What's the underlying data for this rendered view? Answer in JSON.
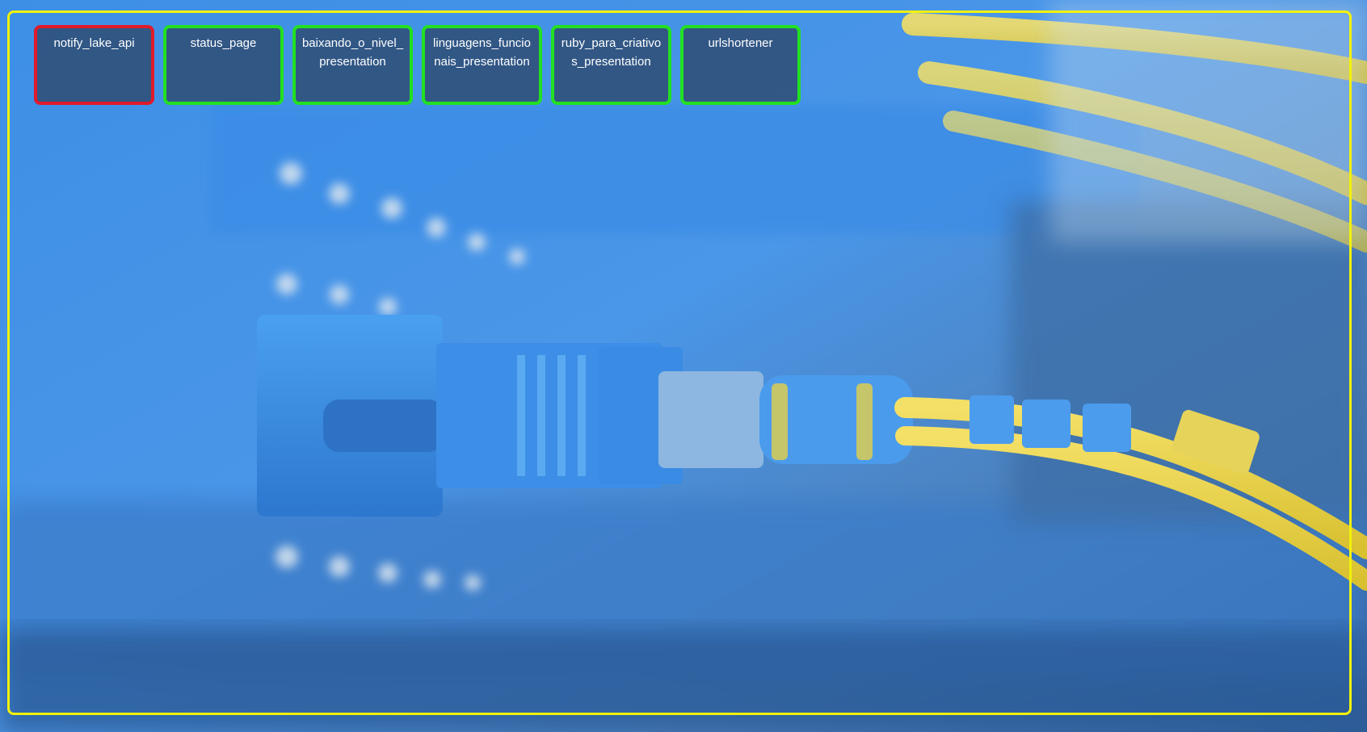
{
  "tiles": [
    {
      "label": "notify_lake_api",
      "status": "down"
    },
    {
      "label": "status_page",
      "status": "up"
    },
    {
      "label": "baixando_o_nivel_presentation",
      "status": "up"
    },
    {
      "label": "linguagens_funcionais_presentation",
      "status": "up"
    },
    {
      "label": "ruby_para_criativos_presentation",
      "status": "up"
    },
    {
      "label": "urlshortener",
      "status": "up"
    }
  ],
  "colors": {
    "frame": "#f2f20a",
    "tile_up_border": "#22e022",
    "tile_down_border": "#e01a2a",
    "tile_background": "#2d4669"
  },
  "background": "blue fiber optic connector with yellow cables"
}
